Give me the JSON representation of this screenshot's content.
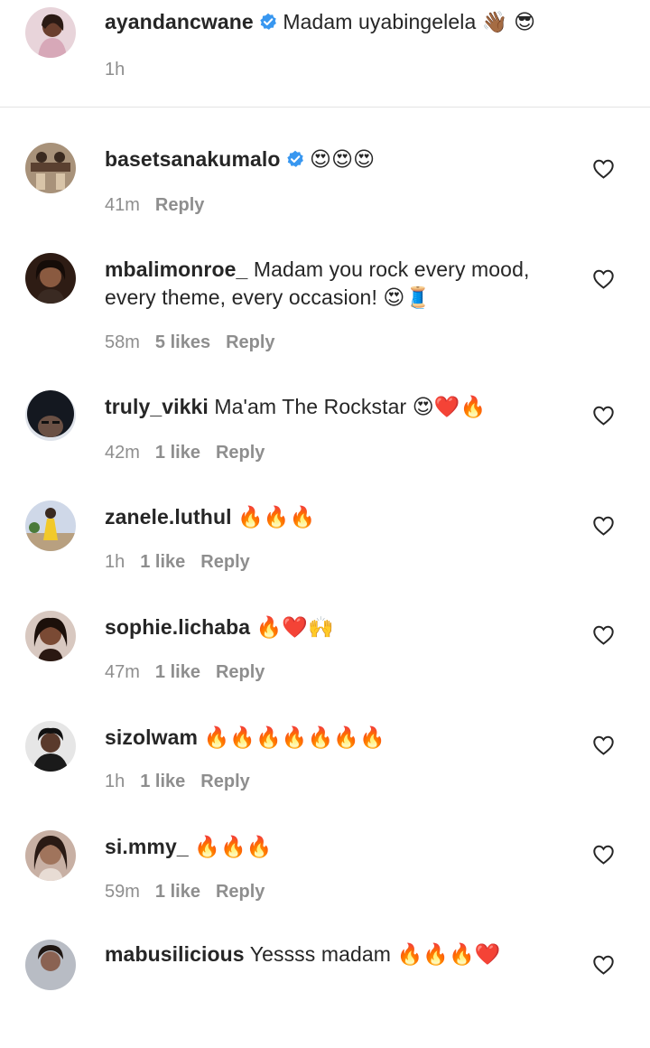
{
  "caption": {
    "username": "ayandancwane",
    "verified": true,
    "text": "Madam uyabingelela 👋🏾 😎",
    "time": "1h"
  },
  "comments": [
    {
      "username": "basetsanakumalo",
      "verified": true,
      "text": "😍😍😍",
      "time": "41m",
      "likes": "",
      "reply": "Reply",
      "avatar_color": "#7a6a58"
    },
    {
      "username": "mbalimonroe_",
      "verified": false,
      "text": "Madam you rock every mood, every theme, every occasion! 😍🧵",
      "time": "58m",
      "likes": "5 likes",
      "reply": "Reply",
      "avatar_color": "#3a2418"
    },
    {
      "username": "truly_vikki",
      "verified": false,
      "text": "Ma'am The Rockstar 😍❤️🔥",
      "time": "42m",
      "likes": "1 like",
      "reply": "Reply",
      "avatar_color": "#1e2230"
    },
    {
      "username": "zanele.luthul",
      "verified": false,
      "text": "🔥🔥🔥",
      "time": "1h",
      "likes": "1 like",
      "reply": "Reply",
      "avatar_color": "#c9b48a"
    },
    {
      "username": "sophie.lichaba",
      "verified": false,
      "text": "🔥❤️🙌",
      "time": "47m",
      "likes": "1 like",
      "reply": "Reply",
      "avatar_color": "#4a2c22"
    },
    {
      "username": "sizolwam",
      "verified": false,
      "text": "🔥🔥🔥🔥🔥🔥🔥",
      "time": "1h",
      "likes": "1 like",
      "reply": "Reply",
      "avatar_color": "#2a2a2a"
    },
    {
      "username": "si.mmy_",
      "verified": false,
      "text": "🔥🔥🔥",
      "time": "59m",
      "likes": "1 like",
      "reply": "Reply",
      "avatar_color": "#6b4a3a"
    },
    {
      "username": "mabusilicious",
      "verified": false,
      "text": "Yessss madam 🔥🔥🔥❤️",
      "time": "",
      "likes": "",
      "reply": "",
      "avatar_color": "#8a8f96"
    }
  ],
  "colors": {
    "verified_badge": "#3897f0",
    "meta_text": "#8e8e8e",
    "divider": "#e3e3e3"
  },
  "icons": {
    "verified": "verified-badge-icon",
    "like": "heart-outline-icon"
  }
}
